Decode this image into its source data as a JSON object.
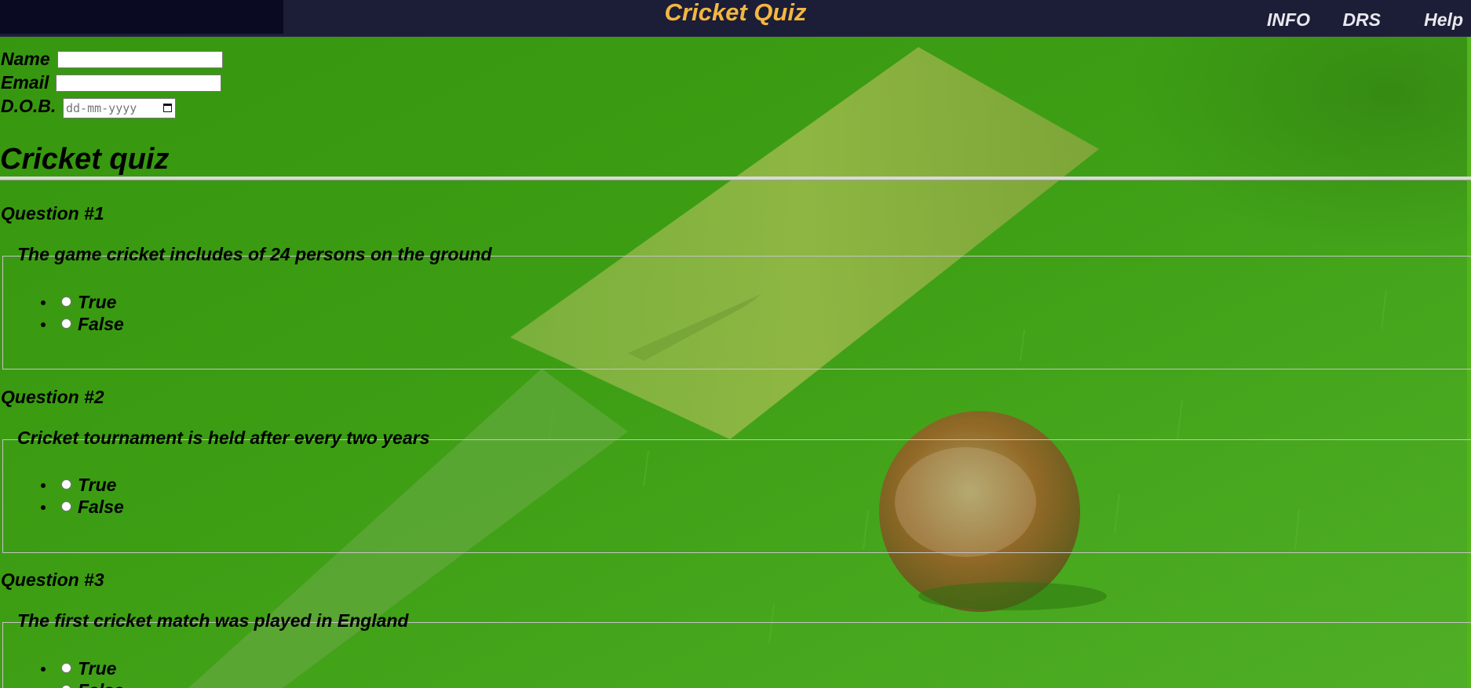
{
  "header": {
    "title": "Cricket Quiz",
    "nav": [
      "INFO",
      "DRS",
      "Help"
    ]
  },
  "form": {
    "name_label": "Name",
    "email_label": "Email",
    "dob_label": "D.O.B.",
    "dob_placeholder": "dd-mm-yyyy"
  },
  "quiz": {
    "title": "Cricket quiz",
    "questions": [
      {
        "label": "Question #1",
        "text": "The game cricket includes of 24 persons on the ground",
        "options": [
          "True",
          "False"
        ]
      },
      {
        "label": "Question #2",
        "text": "Cricket tournament is held after every two years",
        "options": [
          "True",
          "False"
        ]
      },
      {
        "label": "Question #3",
        "text": "The first cricket match was played in England",
        "options": [
          "True",
          "False"
        ]
      }
    ]
  },
  "colors": {
    "header_bg": "#1c1d36",
    "title": "#f2b642",
    "grass": "#3d9a17"
  }
}
